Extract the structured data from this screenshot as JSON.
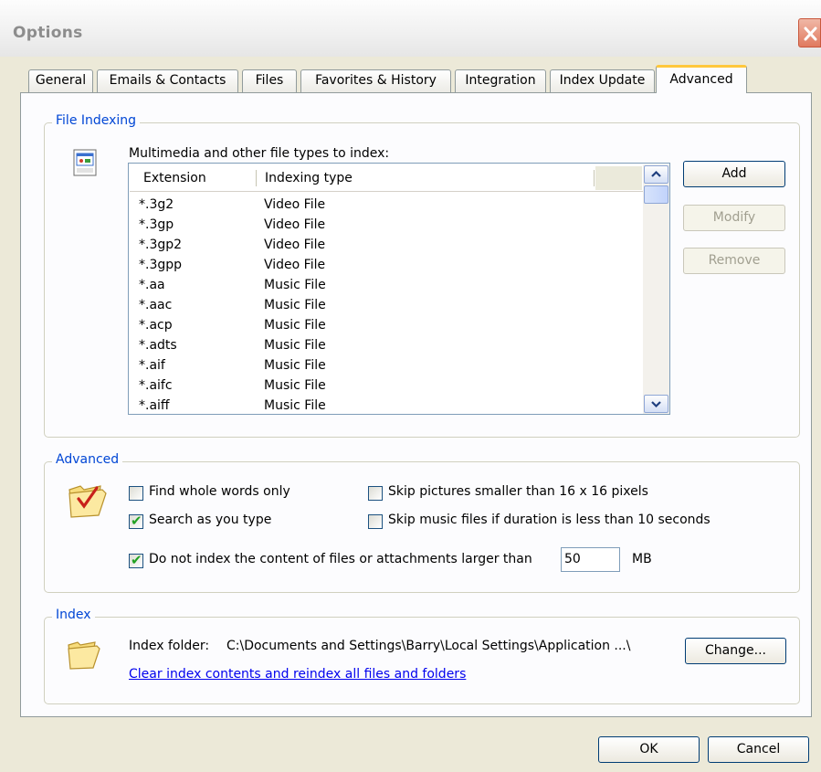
{
  "window": {
    "title": "Options"
  },
  "tabs": [
    {
      "label": "General"
    },
    {
      "label": "Emails & Contacts"
    },
    {
      "label": "Files"
    },
    {
      "label": "Favorites & History"
    },
    {
      "label": "Integration"
    },
    {
      "label": "Index Update"
    },
    {
      "label": "Advanced",
      "active": true
    }
  ],
  "file_indexing": {
    "title": "File Indexing",
    "caption": "Multimedia and other file types to index:",
    "columns": [
      "Extension",
      "Indexing type"
    ],
    "rows": [
      {
        "ext": "*.3g2",
        "type": "Video File"
      },
      {
        "ext": "*.3gp",
        "type": "Video File"
      },
      {
        "ext": "*.3gp2",
        "type": "Video File"
      },
      {
        "ext": "*.3gpp",
        "type": "Video File"
      },
      {
        "ext": "*.aa",
        "type": "Music File"
      },
      {
        "ext": "*.aac",
        "type": "Music File"
      },
      {
        "ext": "*.acp",
        "type": "Music File"
      },
      {
        "ext": "*.adts",
        "type": "Music File"
      },
      {
        "ext": "*.aif",
        "type": "Music File"
      },
      {
        "ext": "*.aifc",
        "type": "Music File"
      },
      {
        "ext": "*.aiff",
        "type": "Music File"
      }
    ],
    "buttons": {
      "add": "Add",
      "modify": "Modify",
      "remove": "Remove"
    }
  },
  "advanced": {
    "title": "Advanced",
    "options": {
      "whole_words": {
        "label": "Find whole words only",
        "checked": false
      },
      "search_as_type": {
        "label": "Search as you type",
        "checked": true
      },
      "skip_small_pics": {
        "label": "Skip pictures smaller than 16 x 16 pixels",
        "checked": false
      },
      "skip_music": {
        "label": "Skip music files if duration is less than 10 seconds",
        "checked": false
      },
      "size_limit": {
        "label": "Do not index the content of files or attachments larger than",
        "checked": true
      }
    },
    "size_limit_value": "50",
    "size_unit": "MB"
  },
  "index": {
    "title": "Index",
    "folder_label": "Index folder:",
    "folder_path": "C:\\Documents and Settings\\Barry\\Local Settings\\Application ...\\",
    "change_button": "Change...",
    "clear_link": "Clear index contents and reindex all files and folders"
  },
  "footer": {
    "ok": "OK",
    "cancel": "Cancel"
  },
  "colors": {
    "group_title": "#0046d5",
    "check": "#21a121",
    "tab_accent": "#ffc83c"
  }
}
